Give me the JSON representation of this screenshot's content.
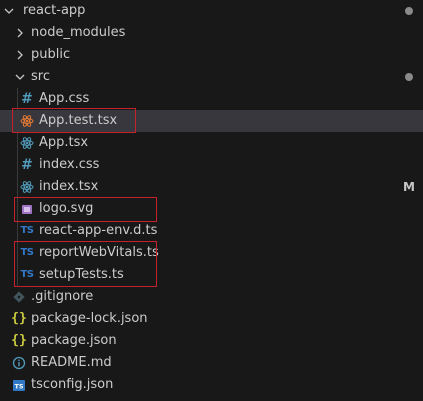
{
  "explorer": {
    "root": {
      "label": "react-app",
      "expanded": true,
      "status_dot": true
    },
    "folders": [
      {
        "label": "node_modules",
        "expanded": false
      },
      {
        "label": "public",
        "expanded": false
      },
      {
        "label": "src",
        "expanded": true,
        "status_dot": true
      }
    ],
    "src_files": [
      {
        "label": "App.css",
        "icon": "css-hash-icon",
        "color": "#519aba"
      },
      {
        "label": "App.test.tsx",
        "icon": "react-test-icon",
        "color": "#e37933",
        "selected": true,
        "highlighted": true
      },
      {
        "label": "App.tsx",
        "icon": "react-icon",
        "color": "#519aba"
      },
      {
        "label": "index.css",
        "icon": "css-hash-icon",
        "color": "#519aba"
      },
      {
        "label": "index.tsx",
        "icon": "react-icon",
        "color": "#519aba",
        "badge": "M"
      },
      {
        "label": "logo.svg",
        "icon": "svg-image-icon",
        "color": "#a074c4",
        "highlighted": true
      },
      {
        "label": "react-app-env.d.ts",
        "icon": "typescript-icon",
        "color": "#3178c6"
      },
      {
        "label": "reportWebVitals.ts",
        "icon": "typescript-icon",
        "color": "#3178c6",
        "highlighted": true
      },
      {
        "label": "setupTests.ts",
        "icon": "typescript-icon",
        "color": "#3178c6",
        "highlighted": true
      }
    ],
    "root_files": [
      {
        "label": ".gitignore",
        "icon": "git-icon",
        "color": "#41535b"
      },
      {
        "label": "package-lock.json",
        "icon": "json-braces-icon",
        "color": "#cbcb41"
      },
      {
        "label": "package.json",
        "icon": "json-braces-icon",
        "color": "#cbcb41"
      },
      {
        "label": "README.md",
        "icon": "info-icon",
        "color": "#519aba"
      },
      {
        "label": "tsconfig.json",
        "icon": "tsconfig-icon",
        "color": "#3178c6"
      }
    ]
  },
  "colors": {
    "background": "#181818",
    "selection": "#37373d",
    "highlight_box": "#c4222a",
    "text": "#cccccc"
  }
}
